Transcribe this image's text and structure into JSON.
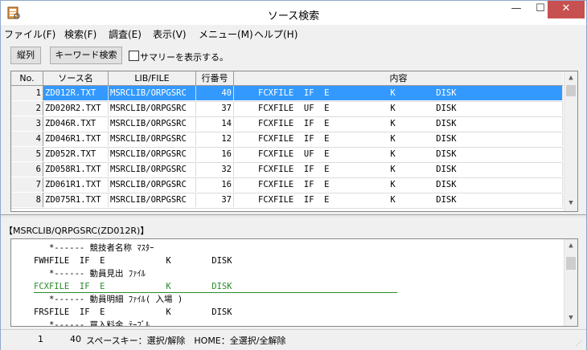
{
  "window": {
    "title": "ソース検索",
    "controls": {
      "minimize": "—",
      "maximize": "☐",
      "close": "✕"
    }
  },
  "menu": [
    "ファイル(F)",
    "検索(F)",
    "調査(E)",
    "表示(V)",
    "メニュー(M)",
    "ヘルプ(H)"
  ],
  "toolbar": {
    "tatretsu_label": "縦列",
    "keyword_search_label": "キーワード検索",
    "summary_checkbox_label": "サマリーを表示する。",
    "summary_checked": false
  },
  "grid": {
    "columns": [
      "No.",
      "ソース名",
      "LIB/FILE",
      "行番号",
      "内容"
    ],
    "rows": [
      {
        "no": "1",
        "source": "ZD012R.TXT",
        "lib": "MSRCLIB/ORPGSRC",
        "line": "40",
        "content": "FCXFILE  IF  E            K        DISK",
        "selected": true
      },
      {
        "no": "2",
        "source": "ZD020R2.TXT",
        "lib": "MSRCLIB/ORPGSRC",
        "line": "37",
        "content": "FCXFILE  UF  E            K        DISK",
        "selected": false
      },
      {
        "no": "3",
        "source": "ZD046R.TXT",
        "lib": "MSRCLIB/ORPGSRC",
        "line": "14",
        "content": "FCXFILE  IF  E            K        DISK",
        "selected": false
      },
      {
        "no": "4",
        "source": "ZD046R1.TXT",
        "lib": "MSRCLIB/ORPGSRC",
        "line": "12",
        "content": "FCXFILE  IF  E            K        DISK",
        "selected": false
      },
      {
        "no": "5",
        "source": "ZD052R.TXT",
        "lib": "MSRCLIB/ORPGSRC",
        "line": "16",
        "content": "FCXFILE  UF  E            K        DISK",
        "selected": false
      },
      {
        "no": "6",
        "source": "ZD058R1.TXT",
        "lib": "MSRCLIB/ORPGSRC",
        "line": "32",
        "content": "FCXFILE  IF  E            K        DISK",
        "selected": false
      },
      {
        "no": "7",
        "source": "ZD061R1.TXT",
        "lib": "MSRCLIB/ORPGSRC",
        "line": "16",
        "content": "FCXFILE  IF  E            K        DISK",
        "selected": false
      },
      {
        "no": "8",
        "source": "ZD075R1.TXT",
        "lib": "MSRCLIB/ORPGSRC",
        "line": "37",
        "content": "FCXFILE  IF  E            K        DISK",
        "selected": false
      }
    ],
    "scroll_up": "▲",
    "scroll_down": "▼"
  },
  "detail": {
    "path_label": "【MSRCLIB/QRPGSRC(ZD012R)】",
    "lines": [
      {
        "text": "   *------ 競技者名称 ﾏｽﾀｰ",
        "highlight": false
      },
      {
        "text": "FWHFILE  IF  E            K        DISK",
        "highlight": false
      },
      {
        "text": "   *------ 動員見出 ﾌｧｲﾙ",
        "highlight": false
      },
      {
        "text": "FCXFILE  IF  E            K        DISK",
        "highlight": true
      },
      {
        "text": "   *------ 動員明細 ﾌｧｲﾙ( 入場 )",
        "highlight": false
      },
      {
        "text": "FRSFILE  IF  E            K        DISK",
        "highlight": false
      },
      {
        "text": "   *------ 買入料金 ﾃｰﾌﾞﾙ",
        "highlight": false
      }
    ],
    "highlight_color": "#2a8a2a"
  },
  "status": {
    "row_number": "1",
    "line_number": "40",
    "hint": "スペースキー：選択/解除　HOME：全選択/全解除"
  },
  "colors": {
    "selection": "#3399ff",
    "close_button": "#c75050"
  }
}
